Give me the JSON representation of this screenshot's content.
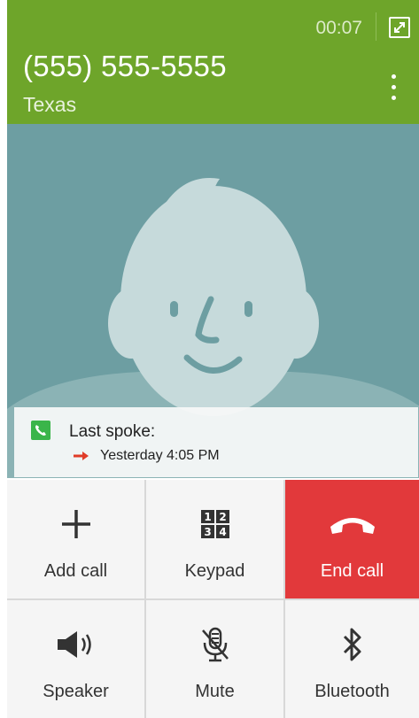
{
  "header": {
    "timer": "00:07",
    "phone_number": "(555) 555-5555",
    "location": "Texas",
    "minimize_icon": "minimize-icon",
    "menu_icon": "more-vertical-icon",
    "color": "#6ea52a"
  },
  "caller_photo": {
    "icon": "default-contact-avatar",
    "background": "#6d9ea2"
  },
  "last_spoke": {
    "title": "Last spoke:",
    "time": "Yesterday 4:05 PM",
    "icon": "phone-icon",
    "arrow_icon": "outgoing-call-arrow-icon"
  },
  "actions": [
    {
      "label": "Add call",
      "icon": "plus-icon"
    },
    {
      "label": "Keypad",
      "icon": "keypad-icon"
    },
    {
      "label": "End call",
      "icon": "end-call-icon",
      "color": "#e2393b"
    },
    {
      "label": "Speaker",
      "icon": "speaker-icon"
    },
    {
      "label": "Mute",
      "icon": "mute-icon"
    },
    {
      "label": "Bluetooth",
      "icon": "bluetooth-icon"
    }
  ]
}
